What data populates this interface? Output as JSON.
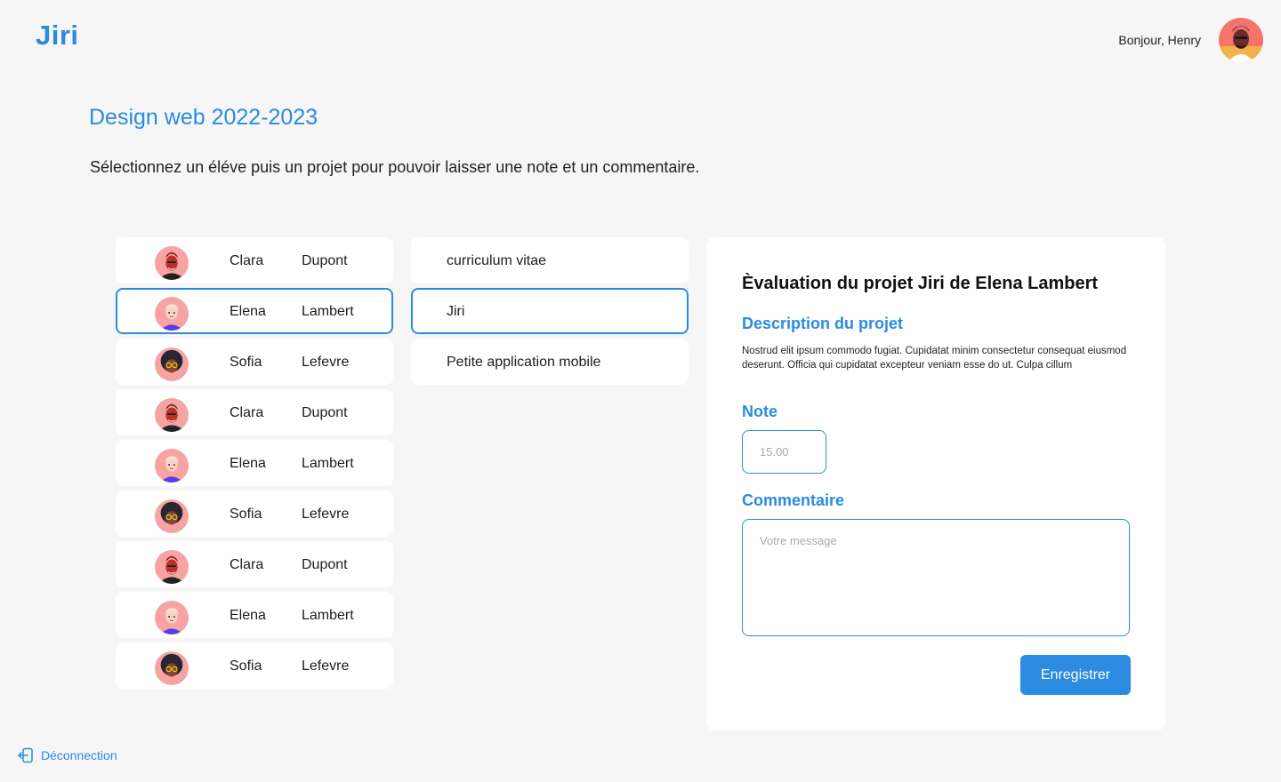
{
  "header": {
    "logo": "Jiri",
    "greeting": "Bonjour, Henry"
  },
  "page": {
    "title": "Design web 2022-2023",
    "intro": "Sélectionnez un éléve puis un projet pour pouvoir laisser une note et un commentaire."
  },
  "students": [
    {
      "first": "Clara",
      "last": "Dupont",
      "avatar": "avatar-clara",
      "selected": false
    },
    {
      "first": "Elena",
      "last": "Lambert",
      "avatar": "avatar-elena",
      "selected": true
    },
    {
      "first": "Sofia",
      "last": "Lefevre",
      "avatar": "avatar-sofia",
      "selected": false
    },
    {
      "first": "Clara",
      "last": "Dupont",
      "avatar": "avatar-clara",
      "selected": false
    },
    {
      "first": "Elena",
      "last": "Lambert",
      "avatar": "avatar-elena",
      "selected": false
    },
    {
      "first": "Sofia",
      "last": "Lefevre",
      "avatar": "avatar-sofia",
      "selected": false
    },
    {
      "first": "Clara",
      "last": "Dupont",
      "avatar": "avatar-clara",
      "selected": false
    },
    {
      "first": "Elena",
      "last": "Lambert",
      "avatar": "avatar-elena",
      "selected": false
    },
    {
      "first": "Sofia",
      "last": "Lefevre",
      "avatar": "avatar-sofia",
      "selected": false
    }
  ],
  "projects": [
    {
      "label": "curriculum vitae",
      "selected": false
    },
    {
      "label": "Jiri",
      "selected": true
    },
    {
      "label": "Petite application mobile",
      "selected": false
    }
  ],
  "evaluation": {
    "title": "Èvaluation du projet Jiri de Elena Lambert",
    "description_label": "Description du projet",
    "description": "Nostrud elit ipsum commodo fugiat. Cupidatat minim consectetur consequat eiusmod deserunt. Officia qui cupidatat excepteur veniam esse do ut. Culpa cillum",
    "note_label": "Note",
    "note_placeholder": "15.00",
    "comment_label": "Commentaire",
    "comment_placeholder": "Votre message",
    "save_label": "Enregistrer"
  },
  "footer": {
    "logout_label": "Déconnection"
  },
  "colors": {
    "accent": "#2a8be0",
    "background": "#f6f6f6"
  }
}
